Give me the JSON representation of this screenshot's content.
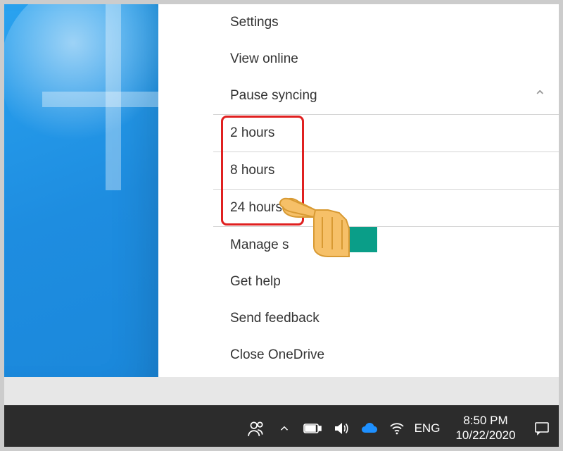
{
  "menu": {
    "settings": "Settings",
    "view_online": "View online",
    "pause_syncing": "Pause syncing",
    "pause_options": {
      "h2": "2 hours",
      "h8": "8 hours",
      "h24": "24 hours"
    },
    "manage_storage": "Manage s",
    "get_help": "Get help",
    "send_feedback": "Send feedback",
    "close": "Close OneDrive"
  },
  "taskbar": {
    "language": "ENG",
    "time": "8:50 PM",
    "date": "10/22/2020"
  },
  "colors": {
    "highlight": "#e02020",
    "accent": "#1e8de0"
  }
}
